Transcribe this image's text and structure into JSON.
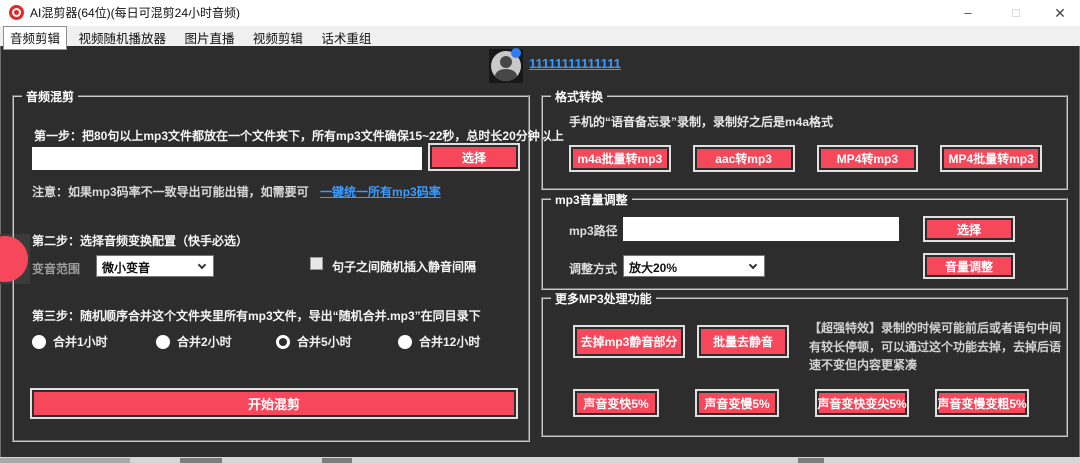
{
  "window": {
    "title": "AI混剪器(64位)(每日可混剪24小时音频)",
    "minimize": "–",
    "maximize": "□",
    "close": "✕"
  },
  "tabs": [
    {
      "label": "音频剪辑",
      "selected": true
    },
    {
      "label": "视频随机播放器",
      "selected": false
    },
    {
      "label": "图片直播",
      "selected": false
    },
    {
      "label": "视频剪辑",
      "selected": false
    },
    {
      "label": "话术重组",
      "selected": false
    }
  ],
  "user": {
    "account_link": "11111111111111"
  },
  "audio_mix": {
    "group_title": "音频混剪",
    "step1": "第一步：把80句以上mp3文件都放在一个文件夹下，所有mp3文件确保15~22秒，总时长20分钟以上",
    "folder_path_value": "",
    "select_button": "选择",
    "note_text": "注意：如果mp3码率不一致导出可能出错，如需要可",
    "note_link": "一键统一所有mp3码率",
    "step2": "第二步：选择音频变换配置（快手必选）",
    "voice_range_label": "变音范围",
    "voice_range_value": "微小变音",
    "silence_checkbox_label": "句子之间随机插入静音间隔",
    "silence_checkbox_checked": false,
    "step3": "第三步：随机顺序合并这个文件夹里所有mp3文件，导出“随机合并.mp3”在同目录下",
    "merge_options": [
      {
        "label": "合并1小时",
        "selected": false
      },
      {
        "label": "合并2小时",
        "selected": false
      },
      {
        "label": "合并5小时",
        "selected": true
      },
      {
        "label": "合并12小时",
        "selected": false
      }
    ],
    "start_button": "开始混剪"
  },
  "format_convert": {
    "group_title": "格式转换",
    "hint": "手机的“语音备忘录”录制，录制好之后是m4a格式",
    "buttons": [
      "m4a批量转mp3",
      "aac转mp3",
      "MP4转mp3",
      "MP4批量转mp3"
    ]
  },
  "volume_adjust": {
    "group_title": "mp3音量调整",
    "path_label": "mp3路径",
    "path_value": "",
    "select_button": "选择",
    "mode_label": "调整方式",
    "mode_value": "放大20%",
    "adjust_button": "音量调整"
  },
  "more_mp3": {
    "group_title": "更多MP3处理功能",
    "remove_silence_button": "去掉mp3静音部分",
    "batch_remove_silence_button": "批量去静音",
    "hint": "【超强特效】录制的时候可能前后或者语句中间有较长停顿，可以通过这个功能去掉，去掉后语速不变但内容更紧凑",
    "speed_buttons": [
      "声音变快5%",
      "声音变慢5%",
      "声音变快变尖5%",
      "声音变慢变粗5%"
    ]
  },
  "colors": {
    "accent_red": "#f7485b",
    "link_blue": "#3a9bff",
    "dark_bg": "#2d2d2d"
  }
}
